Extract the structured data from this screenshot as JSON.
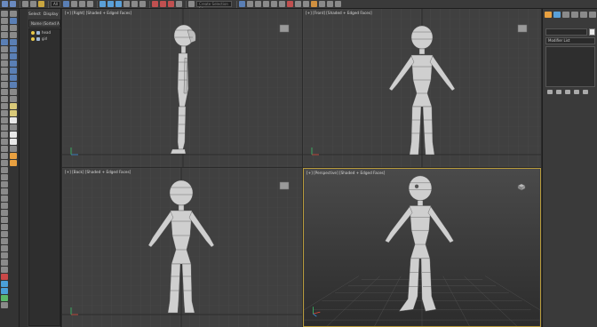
{
  "toolbar": {
    "selection_filter": "All",
    "named_selection_placeholder": "Create Selection Se"
  },
  "scene_explorer": {
    "tabs": [
      "Select",
      "Display"
    ],
    "column_header": "Name (Sorted Ascending)",
    "items": [
      {
        "name": "head",
        "icon": "object-icon"
      },
      {
        "name": "girl",
        "icon": "object-icon"
      }
    ]
  },
  "viewports": {
    "right": {
      "label": "[+] [Right] [Shaded + Edged Faces]"
    },
    "front": {
      "label": "[+] [Front] [Shaded + Edged Faces]"
    },
    "back": {
      "label": "[+] [Back] [Shaded + Edged Faces]"
    },
    "perspective": {
      "label": "[+] [Perspective] [Shaded + Edged Faces]"
    }
  },
  "command_panel": {
    "modifier_list": "Modifier List"
  },
  "colors": {
    "active_viewport_border": "#b89b3c",
    "viewport_bg": "#404040",
    "ui_bg": "#3a3a3a"
  }
}
